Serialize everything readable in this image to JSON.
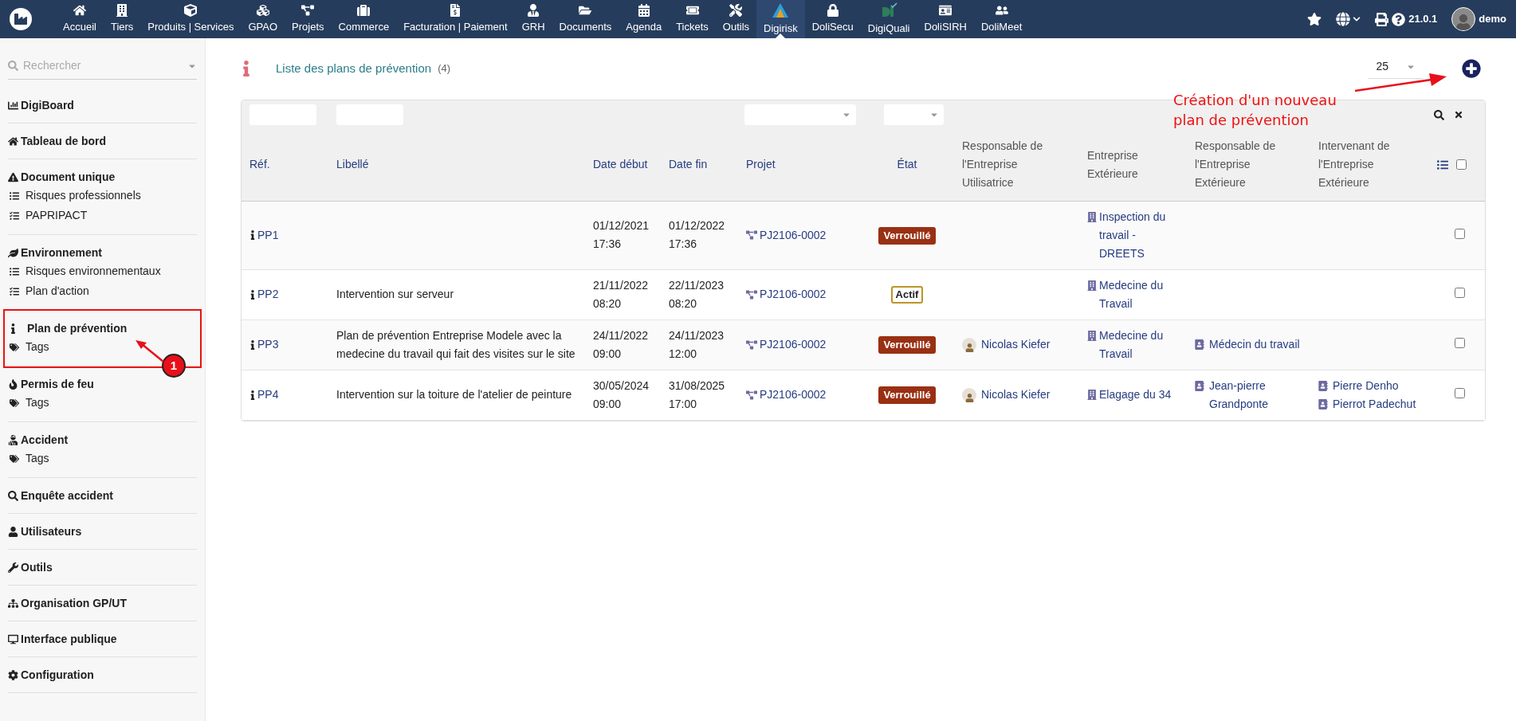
{
  "topbar": {
    "menu": [
      {
        "label": "Accueil",
        "selected": false
      },
      {
        "label": "Tiers",
        "selected": false
      },
      {
        "label": "Produits | Services",
        "selected": false
      },
      {
        "label": "GPAO",
        "selected": false
      },
      {
        "label": "Projets",
        "selected": false
      },
      {
        "label": "Commerce",
        "selected": false
      },
      {
        "label": "Facturation | Paiement",
        "selected": false
      },
      {
        "label": "GRH",
        "selected": false
      },
      {
        "label": "Documents",
        "selected": false
      },
      {
        "label": "Agenda",
        "selected": false
      },
      {
        "label": "Tickets",
        "selected": false
      },
      {
        "label": "Outils",
        "selected": false
      },
      {
        "label": "Digirisk",
        "selected": true
      },
      {
        "label": "DoliSecu",
        "selected": false
      },
      {
        "label": "DigiQuali",
        "selected": false
      },
      {
        "label": "DoliSIRH",
        "selected": false
      },
      {
        "label": "DoliMeet",
        "selected": false
      }
    ],
    "version": "21.0.1",
    "user": "demo"
  },
  "sidebar": {
    "search": {
      "placeholder": "Rechercher"
    },
    "sections": [
      {
        "title": "DigiBoard",
        "highlighted": false
      },
      {
        "title": "Tableau de bord",
        "highlighted": false
      },
      {
        "title": "Document unique",
        "highlighted": false,
        "items": [
          {
            "label": "Risques professionnels"
          },
          {
            "label": "PAPRIPACT"
          }
        ]
      },
      {
        "title": "Environnement",
        "highlighted": false,
        "items": [
          {
            "label": "Risques environnementaux"
          },
          {
            "label": "Plan d'action"
          }
        ]
      },
      {
        "title": "Plan de prévention",
        "highlighted": true,
        "items": [
          {
            "label": "Tags"
          }
        ]
      },
      {
        "title": "Permis de feu",
        "highlighted": false,
        "items": [
          {
            "label": "Tags"
          }
        ]
      },
      {
        "title": "Accident",
        "highlighted": false,
        "items": [
          {
            "label": "Tags"
          }
        ]
      },
      {
        "title": "Enquête accident",
        "highlighted": false
      },
      {
        "title": "Utilisateurs",
        "highlighted": false
      },
      {
        "title": "Outils",
        "highlighted": false
      },
      {
        "title": "Organisation GP/UT",
        "highlighted": false
      },
      {
        "title": "Interface publique",
        "highlighted": false
      },
      {
        "title": "Configuration",
        "highlighted": false
      }
    ]
  },
  "page": {
    "title": "Liste des plans de prévention",
    "count": "(4)",
    "page_size": "25"
  },
  "table": {
    "columns": [
      {
        "label": "Réf.",
        "sortable": true
      },
      {
        "label": "Libellé",
        "sortable": true
      },
      {
        "label": "Date début",
        "sortable": true
      },
      {
        "label": "Date fin",
        "sortable": true
      },
      {
        "label": "Projet",
        "sortable": true
      },
      {
        "label": "État",
        "sortable": true
      },
      {
        "label": "Responsable de l'Entreprise Utilisatrice",
        "sortable": false
      },
      {
        "label": "Entreprise Extérieure",
        "sortable": false
      },
      {
        "label": "Responsable de l'Entreprise Extérieure",
        "sortable": false
      },
      {
        "label": "Intervenant de l'Entreprise Extérieure",
        "sortable": false
      }
    ],
    "select_all": {
      "checked": false
    },
    "rows": [
      {
        "ref": "PP1",
        "label": "",
        "start": "01/12/2021 17:36",
        "end": "01/12/2022 17:36",
        "project": "PJ2106-0002",
        "status": {
          "text": "Verrouillé",
          "kind": "locked"
        },
        "user_manager": "",
        "company": "Inspection du travail - DREETS",
        "contact_manager": "",
        "workers": [],
        "checked": false
      },
      {
        "ref": "PP2",
        "label": "Intervention sur serveur",
        "start": "21/11/2022 08:20",
        "end": "22/11/2023 08:20",
        "project": "PJ2106-0002",
        "status": {
          "text": "Actif",
          "kind": "active"
        },
        "user_manager": "",
        "company": "Medecine du Travail",
        "contact_manager": "",
        "workers": [],
        "checked": false
      },
      {
        "ref": "PP3",
        "label": "Plan de prévention Entreprise Modele avec la medecine du travail qui fait des visites sur le site",
        "start": "24/11/2022 09:00",
        "end": "24/11/2023 12:00",
        "project": "PJ2106-0002",
        "status": {
          "text": "Verrouillé",
          "kind": "locked"
        },
        "user_manager": "Nicolas Kiefer",
        "company": "Medecine du Travail",
        "contact_manager": "Médecin du travail",
        "workers": [],
        "checked": false
      },
      {
        "ref": "PP4",
        "label": "Intervention sur la toiture de l'atelier de peinture",
        "start": "30/05/2024 09:00",
        "end": "31/08/2025 17:00",
        "project": "PJ2106-0002",
        "status": {
          "text": "Verrouillé",
          "kind": "locked"
        },
        "user_manager": "Nicolas Kiefer",
        "company": "Elagage du 34",
        "contact_manager": "Jean-pierre Grandponte",
        "workers": [
          "Pierre Denho",
          "Pierrot Padechut"
        ],
        "checked": false
      }
    ]
  },
  "annotations": {
    "step_badge": "1",
    "callout": "Création d'un nouveau plan de prévention"
  }
}
